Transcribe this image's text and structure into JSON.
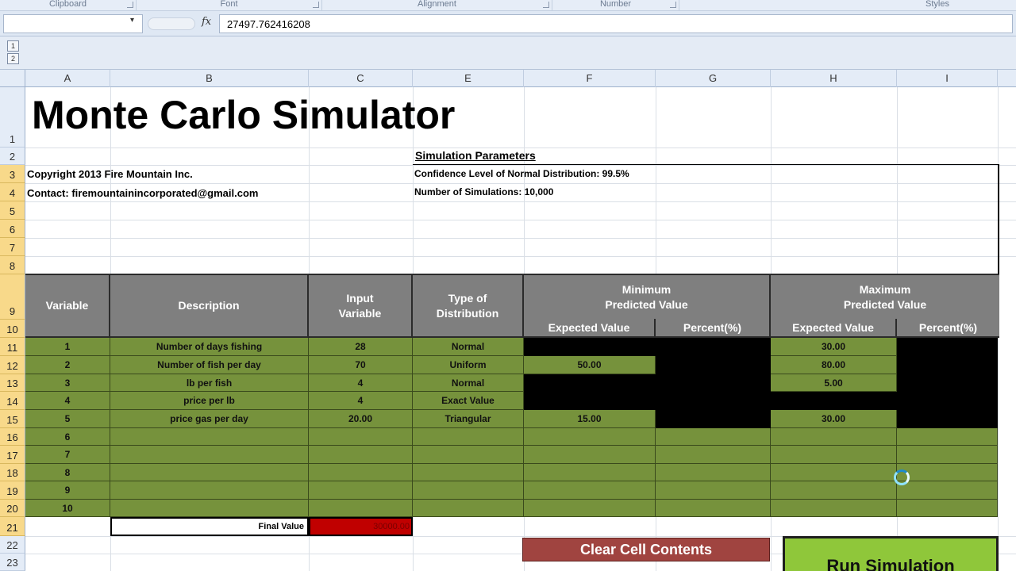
{
  "ribbon": {
    "groups": [
      "Clipboard",
      "Font",
      "Alignment",
      "Number",
      "Styles"
    ]
  },
  "formula_bar": {
    "fx_label": "fx",
    "content": "27497.762416208"
  },
  "outline": {
    "levels": [
      "1",
      "2"
    ]
  },
  "columns": [
    "A",
    "B",
    "C",
    "E",
    "F",
    "G",
    "H",
    "I"
  ],
  "rows": [
    "1",
    "2",
    "3",
    "4",
    "5",
    "6",
    "7",
    "8",
    "9",
    "10",
    "11",
    "12",
    "13",
    "14",
    "15",
    "16",
    "17",
    "18",
    "19",
    "20",
    "21",
    "22",
    "23"
  ],
  "sheet": {
    "title": "Monte Carlo Simulator",
    "copyright": "Copyright 2013 Fire Mountain Inc.",
    "contact": "Contact: firemountainincorporated@gmail.com",
    "sim_params_heading": "Simulation Parameters",
    "confidence": "Confidence Level of Normal Distribution: 99.5%",
    "num_sims": "Number of Simulations: 10,000"
  },
  "table": {
    "headers": {
      "variable": "Variable",
      "description": "Description",
      "input_variable": "Input Variable",
      "type_of_distribution": "Type of Distribution",
      "minimum": "Minimum Predicted Value",
      "maximum": "Maximum Predicted Value",
      "expected_value": "Expected Value",
      "percent": "Percent(%)"
    },
    "rows": [
      {
        "var": "1",
        "desc": "Number of days fishing",
        "input": "28",
        "dist": "Normal",
        "min_ev": "",
        "max_ev": "30.00"
      },
      {
        "var": "2",
        "desc": "Number of fish per day",
        "input": "70",
        "dist": "Uniform",
        "min_ev": "50.00",
        "max_ev": "80.00"
      },
      {
        "var": "3",
        "desc": "lb per fish",
        "input": "4",
        "dist": "Normal",
        "min_ev": "",
        "max_ev": "5.00"
      },
      {
        "var": "4",
        "desc": "price per lb",
        "input": "4",
        "dist": "Exact Value",
        "min_ev": "",
        "max_ev": ""
      },
      {
        "var": "5",
        "desc": "price gas per day",
        "input": "20.00",
        "dist": "Triangular",
        "min_ev": "15.00",
        "max_ev": "30.00"
      },
      {
        "var": "6",
        "desc": "",
        "input": "",
        "dist": "",
        "min_ev": "",
        "max_ev": ""
      },
      {
        "var": "7",
        "desc": "",
        "input": "",
        "dist": "",
        "min_ev": "",
        "max_ev": ""
      },
      {
        "var": "8",
        "desc": "",
        "input": "",
        "dist": "",
        "min_ev": "",
        "max_ev": ""
      },
      {
        "var": "9",
        "desc": "",
        "input": "",
        "dist": "",
        "min_ev": "",
        "max_ev": ""
      },
      {
        "var": "10",
        "desc": "",
        "input": "",
        "dist": "",
        "min_ev": "",
        "max_ev": ""
      }
    ],
    "final_value_label": "Final Value",
    "final_value": "30000.00"
  },
  "buttons": {
    "clear": "Clear Cell Contents",
    "run": "Run Simulation"
  },
  "colors": {
    "table_green": "#76923c",
    "header_gray": "#7f7f7f",
    "final_red": "#c00000",
    "clear_button": "#a04440",
    "run_button": "#8fc73a",
    "selected_row_header": "#f8d98a"
  }
}
